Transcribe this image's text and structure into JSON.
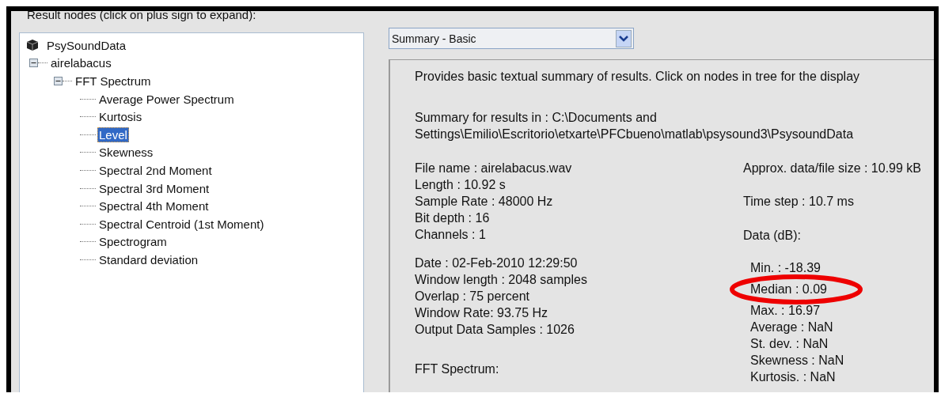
{
  "tree_label": "Result nodes (click on plus sign to expand):",
  "tree": [
    {
      "label": "PsySoundData",
      "kind": "root",
      "selected": false,
      "children": [
        {
          "label": "airelabacus",
          "kind": "folder",
          "selected": false,
          "expanded": true,
          "children": [
            {
              "label": "FFT Spectrum",
              "kind": "folder",
              "selected": false,
              "expanded": true,
              "children": [
                {
                  "label": "Average Power Spectrum",
                  "kind": "leaf",
                  "selected": false
                },
                {
                  "label": "Kurtosis",
                  "kind": "leaf",
                  "selected": false
                },
                {
                  "label": "Level",
                  "kind": "leaf",
                  "selected": true
                },
                {
                  "label": "Skewness",
                  "kind": "leaf",
                  "selected": false
                },
                {
                  "label": "Spectral 2nd Moment",
                  "kind": "leaf",
                  "selected": false
                },
                {
                  "label": "Spectral 3rd Moment",
                  "kind": "leaf",
                  "selected": false
                },
                {
                  "label": "Spectral 4th Moment",
                  "kind": "leaf",
                  "selected": false
                },
                {
                  "label": "Spectral Centroid (1st Moment)",
                  "kind": "leaf",
                  "selected": false
                },
                {
                  "label": "Spectrogram",
                  "kind": "leaf",
                  "selected": false
                },
                {
                  "label": "Standard deviation",
                  "kind": "leaf",
                  "selected": false
                }
              ]
            }
          ]
        }
      ]
    }
  ],
  "display_select": {
    "value": "Summary - Basic"
  },
  "summary": {
    "intro": "Provides basic textual summary of results. Click on nodes in tree for the display",
    "location": [
      "Summary for results in : C:\\Documents and",
      "Settings\\Emilio\\Escritorio\\etxarte\\PFCbueno\\matlab\\psysound3\\PsysoundData"
    ],
    "left_groups": [
      [
        "File name : airelabacus.wav",
        "Length : 10.92 s",
        "Sample Rate : 48000 Hz",
        "Bit depth : 16",
        "Channels : 1"
      ],
      [
        "Date : 02-Feb-2010 12:29:50",
        "Window length  : 2048 samples",
        "Overlap  : 75 percent",
        "Window Rate: 93.75 Hz",
        "Output Data Samples : 1026"
      ]
    ],
    "section": "FFT Spectrum:",
    "right_info": [
      "Approx. data/file size : 10.99 kB",
      "Time step : 10.7 ms",
      "Data (dB):"
    ],
    "stats": [
      {
        "text": "Min. : -18.39",
        "circled": false
      },
      {
        "text": "Median : 0.09",
        "circled": true
      },
      {
        "text": "Max. : 16.97",
        "circled": false
      },
      {
        "text": "Average : NaN",
        "circled": false
      },
      {
        "text": "St. dev. : NaN",
        "circled": false
      },
      {
        "text": "Skewness : NaN",
        "circled": false
      },
      {
        "text": "Kurtosis. : NaN",
        "circled": false
      }
    ]
  }
}
